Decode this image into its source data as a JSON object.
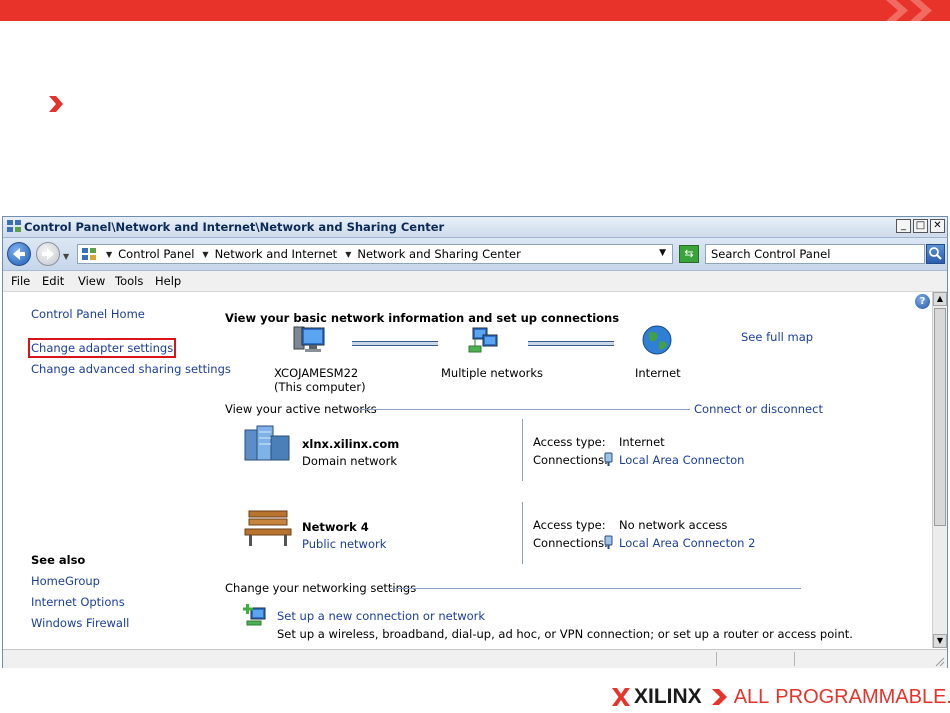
{
  "window": {
    "title": "Control Panel\\Network and Internet\\Network and Sharing Center",
    "controls": {
      "minimize": "_",
      "maximize": "□",
      "close": "✕"
    }
  },
  "address": {
    "crumbs": [
      "Control Panel",
      "Network and Internet",
      "Network and Sharing Center"
    ],
    "search_placeholder": "Search Control Panel"
  },
  "menu": [
    "File",
    "Edit",
    "View",
    "Tools",
    "Help"
  ],
  "sidebar": {
    "home": "Control Panel Home",
    "links": [
      "Change adapter settings",
      "Change advanced sharing settings"
    ],
    "see_also_title": "See also",
    "see_also": [
      "HomeGroup",
      "Internet Options",
      "Windows Firewall"
    ]
  },
  "main": {
    "heading": "View your basic network information and set up connections",
    "see_full_map": "See full map",
    "map": {
      "computer": "XCOJAMESM22",
      "computer_sub": "(This computer)",
      "networks": "Multiple networks",
      "internet": "Internet"
    },
    "active_networks_label": "View your active networks",
    "connect_disconnect": "Connect or disconnect",
    "networks": [
      {
        "name": "xlnx.xilinx.com",
        "type": "Domain network",
        "access_label": "Access type:",
        "access_value": "Internet",
        "conn_label": "Connections:",
        "conn_value": "Local Area Connecton"
      },
      {
        "name": "Network  4",
        "type": "Public network",
        "access_label": "Access type:",
        "access_value": "No network access",
        "conn_label": "Connections:",
        "conn_value": "Local Area Connecton 2"
      }
    ],
    "change_settings_label": "Change your networking settings",
    "setup_link": "Set up a new connection or network",
    "setup_desc": "Set up a wireless, broadband, dial-up, ad hoc, or VPN connection; or set up a router or access point."
  },
  "branding": {
    "logo_text": "XILINX",
    "tagline_a": "ALL",
    "tagline_b": "PROGRAMMABLE."
  },
  "colors": {
    "accent_red": "#e8332a",
    "link_blue": "#1a3f9c"
  }
}
